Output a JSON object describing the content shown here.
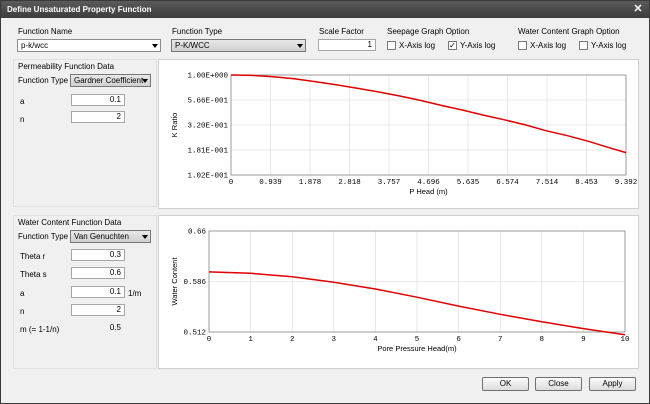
{
  "window": {
    "title": "Define Unsaturated Property Function",
    "close_glyph": "✕"
  },
  "top": {
    "function_name_label": "Function Name",
    "function_name_value": "p-k/wcc",
    "function_type_label": "Function Type",
    "function_type_value": "P-K/WCC",
    "scale_factor_label": "Scale Factor",
    "scale_factor_value": "1",
    "seepage_label": "Seepage Graph Option",
    "seepage_x_label": "X-Axis log",
    "seepage_x_checked": "",
    "seepage_y_label": "Y-Axis log",
    "seepage_y_checked": "✓",
    "wc_label": "Water Content Graph Option",
    "wc_x_label": "X-Axis log",
    "wc_x_checked": "",
    "wc_y_label": "Y-Axis log",
    "wc_y_checked": ""
  },
  "perm": {
    "title": "Permeability Function Data",
    "type_label": "Function Type",
    "type_value": "Gardner Coefficient",
    "a_label": "a",
    "a_value": "0.1",
    "n_label": "n",
    "n_value": "2"
  },
  "wc": {
    "title": "Water Content Function Data",
    "type_label": "Function Type",
    "type_value": "Van Genuchten",
    "theta_r_label": "Theta r",
    "theta_r_value": "0.3",
    "theta_s_label": "Theta s",
    "theta_s_value": "0.6",
    "a_label": "a",
    "a_value": "0.1",
    "a_unit": "1/m",
    "n_label": "n",
    "n_value": "2",
    "m_label": "m (= 1-1/n)",
    "m_value": "0.5"
  },
  "buttons": {
    "ok": "OK",
    "close": "Close",
    "apply": "Apply"
  },
  "colors": {
    "curve": "#e00000",
    "grid": "#d8d8d8"
  },
  "chart_data": [
    {
      "type": "line",
      "xlabel": "P Head (m)",
      "ylabel": "K Ratio",
      "x_ticks": [
        "0",
        "0.939",
        "1.878",
        "2.818",
        "3.757",
        "4.696",
        "5.635",
        "6.574",
        "7.514",
        "8.453",
        "9.392"
      ],
      "y_ticks": [
        "1.00E+000",
        "5.66E-001",
        "3.20E-001",
        "1.81E-001",
        "1.02E-001"
      ],
      "xlim": [
        0,
        9.392
      ],
      "ylim": [
        0.102,
        1.0
      ],
      "series": [
        {
          "x": [
            0,
            0.5,
            1,
            1.5,
            2,
            2.5,
            3,
            3.5,
            4,
            4.5,
            5,
            5.5,
            6,
            6.5,
            7,
            7.5,
            8,
            8.5,
            9,
            9.392
          ],
          "y": [
            1.0,
            0.99,
            0.96,
            0.92,
            0.86,
            0.8,
            0.74,
            0.68,
            0.62,
            0.56,
            0.5,
            0.45,
            0.4,
            0.36,
            0.32,
            0.28,
            0.25,
            0.22,
            0.19,
            0.17
          ]
        }
      ]
    },
    {
      "type": "line",
      "xlabel": "Pore Pressure Head(m)",
      "ylabel": "Water Content",
      "x_ticks": [
        "0",
        "1",
        "2",
        "3",
        "4",
        "5",
        "6",
        "7",
        "8",
        "9",
        "10"
      ],
      "y_ticks": [
        "0.66",
        "0.586",
        "0.512"
      ],
      "xlim": [
        0,
        10
      ],
      "ylim": [
        0.512,
        0.66
      ],
      "series": [
        {
          "x": [
            0,
            1,
            2,
            3,
            4,
            5,
            6,
            7,
            8,
            9,
            10
          ],
          "y": [
            0.6,
            0.598,
            0.593,
            0.585,
            0.575,
            0.563,
            0.55,
            0.538,
            0.527,
            0.517,
            0.508
          ]
        }
      ]
    }
  ]
}
